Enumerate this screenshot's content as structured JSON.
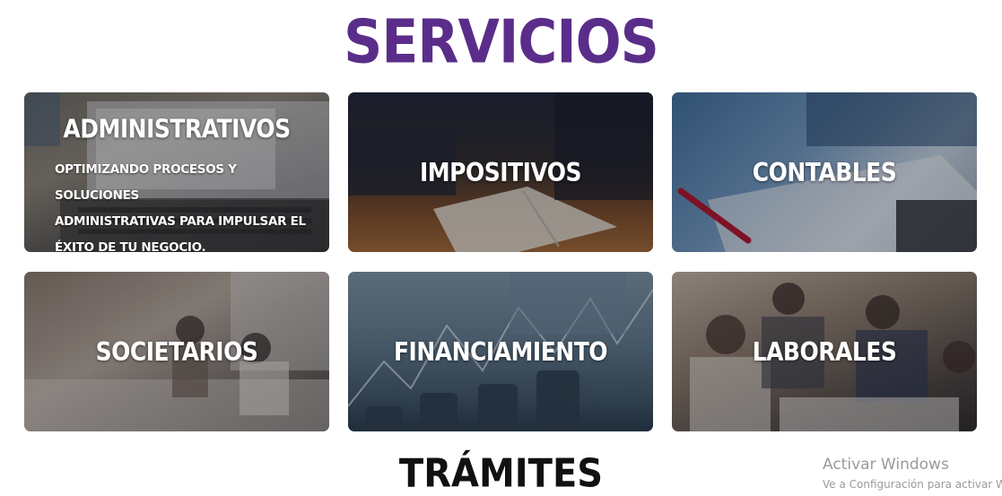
{
  "header": {
    "title": "SERVICIOS",
    "title_color": "#5b2d8a"
  },
  "cards": [
    {
      "title": "ADMINISTRATIVOS",
      "description_lines": [
        "OPTIMIZANDO PROCESOS Y SOLUCIONES",
        "ADMINISTRATIVAS PARA IMPULSAR EL",
        "ÉXITO DE TU NEGOCIO."
      ],
      "image": "laptop-spreadsheet-photo"
    },
    {
      "title": "IMPOSITIVOS",
      "image": "notebook-desk-photo"
    },
    {
      "title": "CONTABLES",
      "image": "calculator-papers-photo"
    },
    {
      "title": "SOCIETARIOS",
      "image": "office-team-photo"
    },
    {
      "title": "FINANCIAMIENTO",
      "image": "coins-chart-photo"
    },
    {
      "title": "LABORALES",
      "image": "team-meeting-photo"
    }
  ],
  "next_section": {
    "title": "TRÁMITES"
  },
  "watermark": {
    "title": "Activar Windows",
    "subtitle": "Ve a Configuración para activar Windows."
  }
}
